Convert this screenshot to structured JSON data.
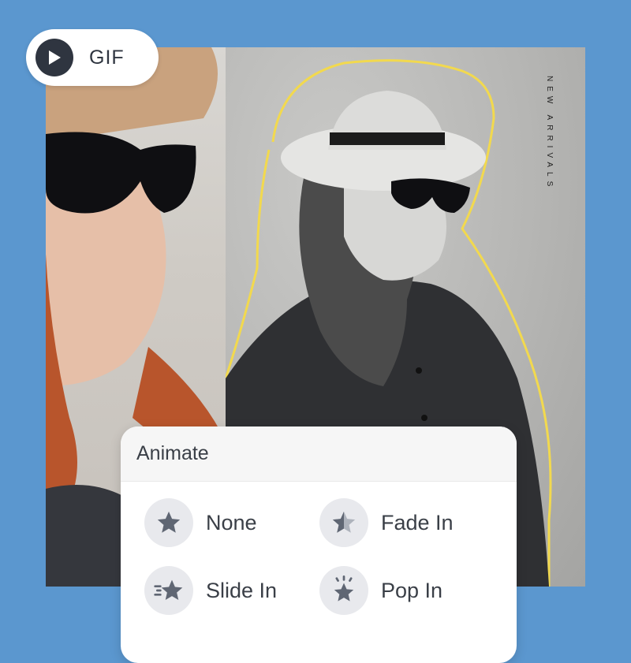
{
  "gif_badge": {
    "label": "GIF",
    "icon": "play-icon"
  },
  "poster": {
    "vertical_text": "NEW ARRIVALS"
  },
  "animate_panel": {
    "title": "Animate",
    "options": [
      {
        "label": "None",
        "icon": "star-icon"
      },
      {
        "label": "Fade In",
        "icon": "star-half-icon"
      },
      {
        "label": "Slide In",
        "icon": "star-motion-lines-icon"
      },
      {
        "label": "Pop In",
        "icon": "star-pop-icon"
      }
    ]
  },
  "colors": {
    "background": "#5b97cf",
    "accent_outline": "#f2d94e",
    "icon_fill": "#5f6673",
    "icon_bg": "#e8e9ed",
    "text": "#3a3f47"
  }
}
